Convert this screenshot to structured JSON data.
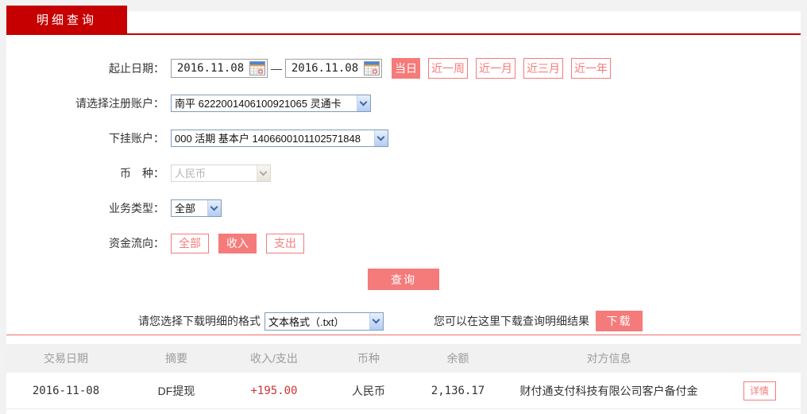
{
  "tab": {
    "label": "明细查询"
  },
  "form": {
    "date_range": {
      "label": "起止日期：",
      "start": "2016.11.08",
      "end": "2016.11.08",
      "separator": "—",
      "quick_buttons": [
        {
          "label": "当日",
          "active": true
        },
        {
          "label": "近一周",
          "active": false
        },
        {
          "label": "近一月",
          "active": false
        },
        {
          "label": "近三月",
          "active": false
        },
        {
          "label": "近一年",
          "active": false
        }
      ]
    },
    "register_account": {
      "label": "请选择注册账户：",
      "value": "南平 6222001406100921065 灵通卡"
    },
    "sub_account": {
      "label": "下挂账户：",
      "value": "000 活期 基本户 1406600101102571848"
    },
    "currency": {
      "label": "币　种：",
      "value": "人民币",
      "disabled": true
    },
    "business_type": {
      "label": "业务类型：",
      "value": "全部"
    },
    "fund_flow": {
      "label": "资金流向：",
      "options": [
        {
          "label": "全部",
          "active": false
        },
        {
          "label": "收入",
          "active": true
        },
        {
          "label": "支出",
          "active": false
        }
      ]
    },
    "query_button": "查询"
  },
  "download": {
    "format_label": "请您选择下载明细的格式",
    "format_value": "文本格式（.txt）",
    "hint": "您可以在这里下载查询明细结果",
    "button": "下载"
  },
  "table": {
    "headers": [
      "交易日期",
      "摘要",
      "收入/支出",
      "币种",
      "余额",
      "对方信息"
    ],
    "rows": [
      {
        "date": "2016-11-08",
        "summary": "DF提现",
        "amount": "+195.00",
        "currency": "人民币",
        "balance": "2,136.17",
        "counterparty": "财付通支付科技有限公司客户备付金",
        "action": "详情"
      }
    ]
  },
  "colors": {
    "accent_red": "#c60000",
    "pink": "#f57b7b",
    "income_red": "#cc3333"
  }
}
